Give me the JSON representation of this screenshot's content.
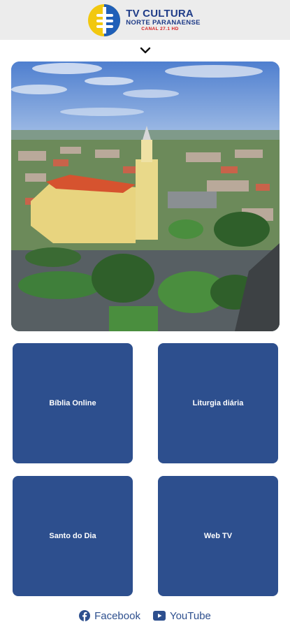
{
  "header": {
    "logo_title": "TV CULTURA",
    "logo_subtitle": "NORTE PARANAENSE",
    "logo_channel": "CANAL 27.1 HD"
  },
  "hero": {
    "icon_expand": "chevron-down-icon"
  },
  "menu": {
    "items": [
      {
        "label": "Bíblia Online"
      },
      {
        "label": "Liturgia diária"
      },
      {
        "label": "Santo do Dia"
      },
      {
        "label": "Web TV"
      }
    ]
  },
  "social": {
    "facebook_label": "Facebook",
    "youtube_label": "YouTube"
  },
  "colors": {
    "tile_blue": "#2d4f8e",
    "header_bg": "#ececec",
    "accent_red": "#d62020"
  }
}
